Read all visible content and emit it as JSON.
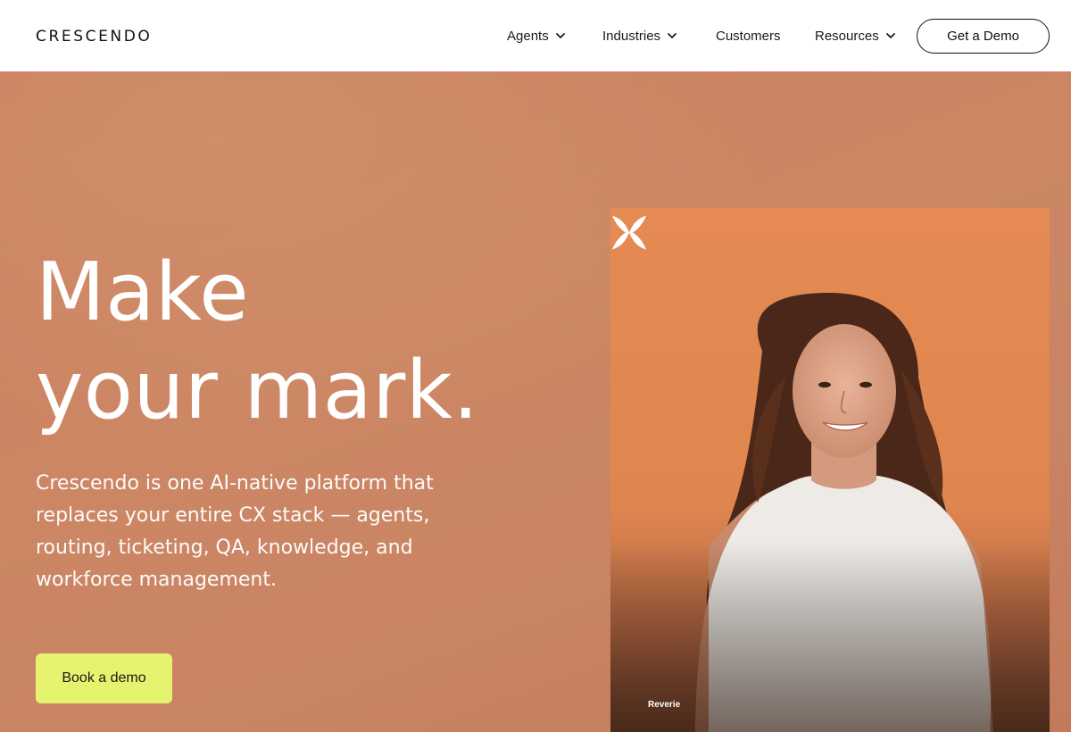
{
  "brand": {
    "name": "CRESCENDO"
  },
  "nav": {
    "items": [
      {
        "label": "Agents",
        "has_dropdown": true
      },
      {
        "label": "Industries",
        "has_dropdown": true
      },
      {
        "label": "Customers",
        "has_dropdown": false
      },
      {
        "label": "Resources",
        "has_dropdown": true
      }
    ],
    "cta_label": "Get a Demo"
  },
  "hero": {
    "headline_line1": "Make",
    "headline_line2": "your mark.",
    "subcopy": "Crescendo is one AI-native platform that replaces your entire CX stack — agents, routing, ticketing, QA, knowledge, and workforce management.",
    "cta_label": "Book a demo"
  },
  "photo": {
    "badge_text": "Reverie",
    "badge_icon": "reverie-logo-icon"
  },
  "colors": {
    "hero_bg": "#c98062",
    "photo_bg": "#e48a52",
    "cta_bg": "#e6f36f",
    "text_dark": "#111111"
  }
}
